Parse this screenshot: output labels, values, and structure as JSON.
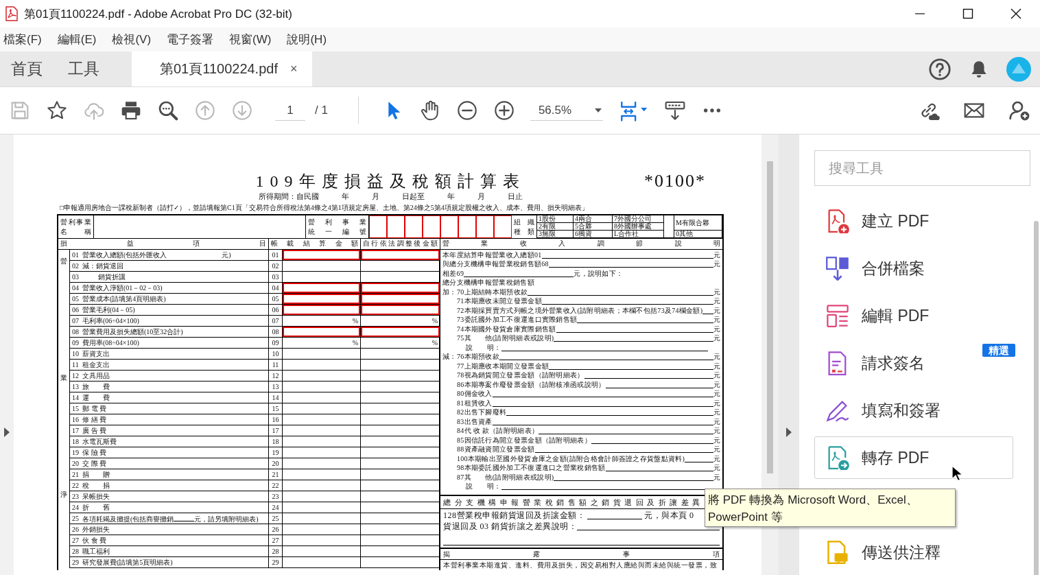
{
  "window": {
    "title": "第01頁1100224.pdf - Adobe Acrobat Pro DC (32-bit)"
  },
  "menu": [
    "檔案(F)",
    "編輯(E)",
    "檢視(V)",
    "電子簽署",
    "視窗(W)",
    "說明(H)"
  ],
  "nav_tabs": [
    {
      "label": "首頁",
      "selected": false
    },
    {
      "label": "工具",
      "selected": false
    },
    {
      "label": "第01頁1100224.pdf",
      "selected": true,
      "close": "×"
    }
  ],
  "toolbar": {
    "items": [
      {
        "kind": "save",
        "disabled": true
      },
      {
        "kind": "bookmark",
        "disabled": false
      },
      {
        "kind": "upload",
        "disabled": true
      },
      {
        "kind": "print",
        "disabled": false
      },
      {
        "kind": "find",
        "disabled": false
      },
      {
        "kind": "prev_page",
        "disabled": true
      },
      {
        "kind": "next_page",
        "disabled": true
      },
      {
        "kind": "page_field",
        "value": "1",
        "total": "/ 1"
      },
      {
        "kind": "separator"
      },
      {
        "kind": "select",
        "selected": true
      },
      {
        "kind": "hand",
        "disabled": false,
        "selected": false
      },
      {
        "kind": "zoom_out",
        "disabled": false
      },
      {
        "kind": "zoom_in",
        "disabled": false
      },
      {
        "kind": "zoom_field",
        "value": "56.5%"
      },
      {
        "kind": "fit_page",
        "disabled": false
      },
      {
        "kind": "scroll_mode",
        "disabled": false
      },
      {
        "kind": "more",
        "disabled": false
      }
    ],
    "right": [
      {
        "kind": "share_link",
        "disabled": false
      },
      {
        "kind": "email",
        "disabled": false
      },
      {
        "kind": "add_user",
        "disabled": false
      }
    ]
  },
  "document": {
    "title": "109年度損益及稅額計算表",
    "form_code": "*0100*",
    "period": "所得期間：自民國　　　年　　　月　　　日起至　　　年　　　月　　　日止",
    "notice": "□申報適用房地合一課稅新制者（請打✓），並請填報第C1頁「交易符合所得稅法第4條之4第1項規定房屋、土地、第24條之5第4項規定股權之收入、成本、費用、損失明細表」",
    "name_label": [
      "營利事業",
      "名稱"
    ],
    "id_label": [
      "營利事業",
      "統一編號"
    ],
    "org_label": [
      "組織",
      "種類"
    ],
    "org_types": [
      "1股份",
      "2有限",
      "3無限",
      "4兩合",
      "5合夥",
      "6獨資",
      "7外國分公司",
      "8外國辦事處",
      "L合作社",
      "M有限合夥",
      "0其他"
    ],
    "columns": [
      "損益項目",
      "帳載結算金額",
      "自行依法調整後金額",
      "營業收入調節說明"
    ],
    "side_labels": [
      "營",
      "業",
      "淨"
    ],
    "rows": [
      {
        "no": "01",
        "label": "營業收入總額(包括外匯收入　　　　　　　　元)",
        "code": "01",
        "highlighted": true
      },
      {
        "no": "02",
        "label": "減：銷貨退回",
        "code": "02",
        "highlighted": false
      },
      {
        "no": "03",
        "label": "　　 銷貨折讓",
        "code": "03",
        "highlighted": false
      },
      {
        "no": "04",
        "label": "營業收入淨額(01－02－03)",
        "code": "04",
        "highlighted": true
      },
      {
        "no": "05",
        "label": "營業成本(請填第4頁明細表)",
        "code": "05",
        "highlighted": true
      },
      {
        "no": "06",
        "label": "營業毛利(04－05)",
        "code": "06",
        "highlighted": true
      },
      {
        "no": "07",
        "label": "毛利率(06÷04×100)",
        "code": "07",
        "highlighted": false,
        "cells": [
          "%",
          "%"
        ]
      },
      {
        "no": "08",
        "label": "營業費用及損失總額(10至32合計)",
        "code": "08",
        "highlighted": true
      },
      {
        "no": "09",
        "label": "費用率(08÷04×100)",
        "code": "09",
        "highlighted": false,
        "cells": [
          "%",
          "%"
        ]
      },
      {
        "no": "10",
        "label": "薪資支出",
        "code": "10",
        "highlighted": false
      },
      {
        "no": "11",
        "label": "租金支出",
        "code": "11",
        "highlighted": false
      },
      {
        "no": "12",
        "label": "文具用品",
        "code": "12",
        "highlighted": false
      },
      {
        "no": "13",
        "label": "旅　　費",
        "code": "13",
        "highlighted": false
      },
      {
        "no": "14",
        "label": "運　　費",
        "code": "14",
        "highlighted": false
      },
      {
        "no": "15",
        "label": "郵 電 費",
        "code": "15",
        "highlighted": false
      },
      {
        "no": "16",
        "label": "修 繕 費",
        "code": "16",
        "highlighted": false
      },
      {
        "no": "17",
        "label": "廣 告 費",
        "code": "17",
        "highlighted": false
      },
      {
        "no": "18",
        "label": "水電瓦斯費",
        "code": "18",
        "highlighted": false
      },
      {
        "no": "19",
        "label": "保 險 費",
        "code": "19",
        "highlighted": false
      },
      {
        "no": "20",
        "label": "交 際 費",
        "code": "20",
        "highlighted": false
      },
      {
        "no": "21",
        "label": "捐　　贈",
        "code": "21",
        "highlighted": false
      },
      {
        "no": "22",
        "label": "稅　　捐",
        "code": "22",
        "highlighted": false
      },
      {
        "no": "23",
        "label": "呆帳損失",
        "code": "23",
        "highlighted": false
      },
      {
        "no": "24",
        "label": "折　　舊",
        "code": "24",
        "highlighted": false
      },
      {
        "no": "25",
        "label": "各項耗竭及攤提(包括商譽攤銷",
        "label_after": "元，請另填附明細表)",
        "code": "25",
        "highlighted": false
      },
      {
        "no": "26",
        "label": "外銷損失",
        "code": "26",
        "highlighted": false
      },
      {
        "no": "27",
        "label": "伙 食 費",
        "code": "27",
        "highlighted": false
      },
      {
        "no": "28",
        "label": "職工福利",
        "code": "28",
        "highlighted": false
      },
      {
        "no": "29",
        "label": "研究發展費(請填第5頁明細表)",
        "code": "29",
        "highlighted": false
      }
    ],
    "reconciliation": [
      {
        "kind": "fill",
        "text": "本年度結算申報營業收入總額01",
        "unit": "元"
      },
      {
        "kind": "fill",
        "text": "與總分支機構申報營業稅銷售額68",
        "unit": "元"
      },
      {
        "kind": "inline",
        "text": "相差69",
        "after": "元，說明如下："
      },
      {
        "kind": "text",
        "text": "總分支機構申報營業稅銷售額"
      },
      {
        "kind": "group",
        "prefix": "加：",
        "children": [
          {
            "kind": "fill",
            "text": "70上期結轉本期預收款",
            "unit": "元"
          },
          {
            "kind": "fill",
            "text": "71本期應收未開立發票金額",
            "unit": "元"
          },
          {
            "kind": "fill",
            "text": "72本期採買賣方式列帳之境外營業收入(請附明細表；本欄不包括73及74欄金額)",
            "unit": "元"
          },
          {
            "kind": "fill",
            "text": "73委託國外加工不復運進口實際銷售額",
            "unit": "元"
          },
          {
            "kind": "fill",
            "text": "74本期國外發貨倉庫實際銷售額",
            "unit": "元"
          },
          {
            "kind": "fill",
            "text": "75其　　他(請附明細表或說明)",
            "unit": "元"
          },
          {
            "kind": "note",
            "text": "說　　明："
          }
        ]
      },
      {
        "kind": "group",
        "prefix": "減：",
        "children": [
          {
            "kind": "fill",
            "text": "76本期預收款",
            "unit": "元"
          },
          {
            "kind": "fill",
            "text": "77上期應收本期開立發票金額",
            "unit": "元"
          },
          {
            "kind": "fill",
            "text": "78視為銷貨開立發票金額（請附明細表）",
            "unit": "元"
          },
          {
            "kind": "fill",
            "text": "86本期專案作廢發票金額（請附核准函或說明）",
            "unit": "元"
          },
          {
            "kind": "fill",
            "text": "80佣金收入",
            "unit": "元"
          },
          {
            "kind": "fill",
            "text": "81租賃收入",
            "unit": "元"
          },
          {
            "kind": "fill",
            "text": "82出售下腳廢料",
            "unit": "元"
          },
          {
            "kind": "fill",
            "text": "83出售資產",
            "unit": "元"
          },
          {
            "kind": "fill",
            "text": "84代 收 款（請附明細表）",
            "unit": "元"
          },
          {
            "kind": "fill",
            "text": "85因信託行為開立發票金額（請附明細表）",
            "unit": "元"
          },
          {
            "kind": "fill",
            "text": "88資產融資開立發票金額",
            "unit": "元"
          },
          {
            "kind": "fill",
            "text": "100本期輸出至國外發貨倉庫之金額(請附合格會計師簽證之存貨盤點資料)",
            "unit": "元"
          },
          {
            "kind": "fill",
            "text": "98本期委託國外加工不復運進口之營業稅銷售額",
            "unit": "元"
          },
          {
            "kind": "fill",
            "text": "87其　　他(請附明細表或說明)",
            "unit": "元"
          },
          {
            "kind": "note",
            "text": "說　　明："
          }
        ]
      }
    ],
    "difference": {
      "title": "總分支機構申報營業稅銷售額之銷貨退回及折讓差異",
      "amount_label": "128營業稅申報銷貨退回及折讓金額：",
      "amount_after": "元，與本頁 0",
      "explain": "貨退回及 03 銷貨折讓之差異說明："
    },
    "disclosure": {
      "title": "揭露事項",
      "text": "本營利事業本期進貨、進料、費用及損失，因交易相對人應給與而未給與統一發票，致"
    }
  },
  "tools_panel": {
    "search_placeholder": "搜尋工具",
    "items": [
      {
        "kind": "create",
        "label": "建立 PDF",
        "hovered": false
      },
      {
        "kind": "combine",
        "label": "合併檔案",
        "hovered": false
      },
      {
        "kind": "edit",
        "label": "編輯 PDF",
        "hovered": false
      },
      {
        "kind": "request_sign",
        "label": "請求簽名",
        "hovered": false,
        "badge": "精選"
      },
      {
        "kind": "fill_sign",
        "label": "填寫和簽署",
        "hovered": false
      },
      {
        "kind": "export",
        "label": "轉存 PDF",
        "hovered": true
      },
      {
        "kind": "comment",
        "label": "傳送供注釋",
        "hovered": false
      }
    ]
  },
  "tooltip": "將 PDF 轉換為 Microsoft Word、Excel、PowerPoint 等"
}
